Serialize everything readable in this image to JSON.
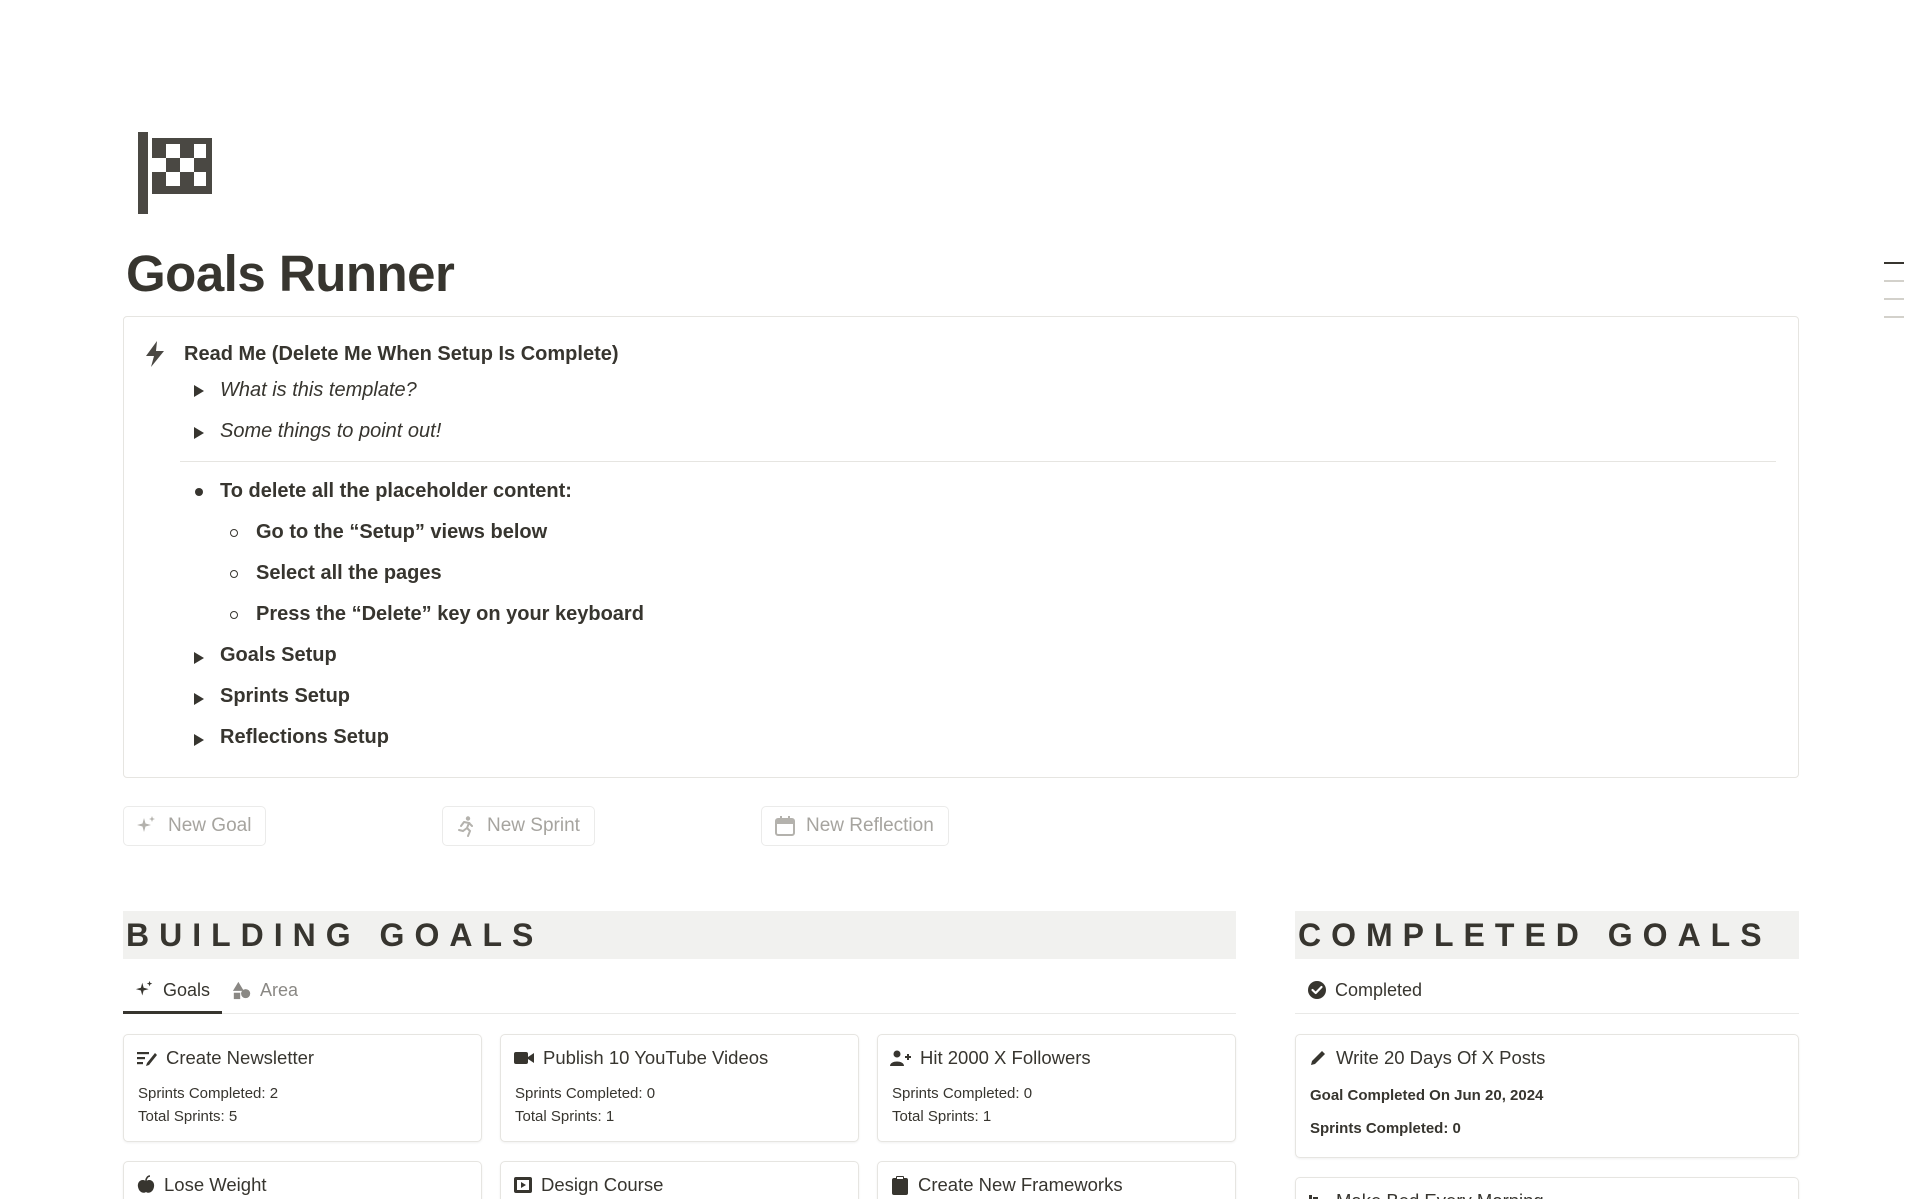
{
  "page": {
    "title": "Goals Runner",
    "icon": "checkered-flag-icon"
  },
  "callout": {
    "icon": "lightning-bolt-icon",
    "title": "Read Me (Delete Me When Setup Is Complete)",
    "toggles_top": [
      {
        "label": "What is this template?"
      },
      {
        "label": "Some things to point out!"
      }
    ],
    "bullet": {
      "label": "To delete all the placeholder content:",
      "sub_items": [
        "Go to the “Setup” views below",
        "Select all the pages",
        "Press the “Delete” key on your keyboard"
      ]
    },
    "toggles_bottom": [
      {
        "label": "Goals Setup"
      },
      {
        "label": "Sprints Setup"
      },
      {
        "label": "Reflections Setup"
      }
    ]
  },
  "buttons": {
    "new_goal": "New Goal",
    "new_sprint": "New Sprint",
    "new_reflection": "New Reflection"
  },
  "building": {
    "heading": "BUILDING GOALS",
    "tabs": [
      {
        "label": "Goals",
        "icon": "sparkles-icon",
        "active": true
      },
      {
        "label": "Area",
        "icon": "shapes-icon",
        "active": false
      }
    ],
    "cards": [
      {
        "title": "Create Newsletter",
        "icon": "newsletter-icon",
        "sprints_completed": "Sprints Completed: 2",
        "total_sprints": "Total Sprints: 5"
      },
      {
        "title": "Publish 10 YouTube Videos",
        "icon": "video-camera-icon",
        "sprints_completed": "Sprints Completed: 0",
        "total_sprints": "Total Sprints: 1"
      },
      {
        "title": "Hit 2000 X Followers",
        "icon": "add-user-icon",
        "sprints_completed": "Sprints Completed: 0",
        "total_sprints": "Total Sprints: 1"
      },
      {
        "title": "Lose Weight",
        "icon": "apple-icon"
      },
      {
        "title": "Design Course",
        "icon": "film-icon"
      },
      {
        "title": "Create New Frameworks",
        "icon": "clipboard-icon"
      }
    ]
  },
  "completed": {
    "heading": "COMPLETED GOALS",
    "tab": {
      "label": "Completed",
      "icon": "check-circle-icon"
    },
    "cards": [
      {
        "title": "Write 20 Days Of X Posts",
        "icon": "pencil-icon",
        "completed_on": "Goal Completed On Jun 20, 2024",
        "sprints_completed": "Sprints Completed: 0"
      },
      {
        "title": "Make Bed Every Morning",
        "icon": "bed-icon"
      }
    ]
  },
  "colors": {
    "text": "#37352f",
    "muted": "#a6a49f",
    "border": "#e6e5e1",
    "heading_bg": "#f1f1ef"
  }
}
